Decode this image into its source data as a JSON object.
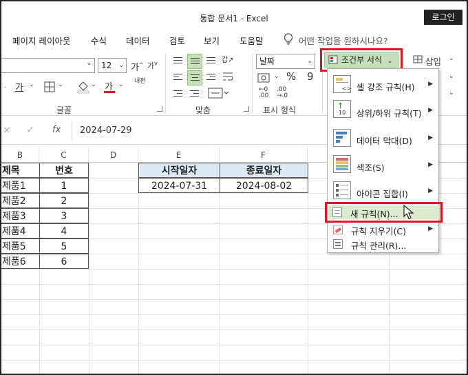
{
  "window": {
    "title": "통합 문서1 - Excel",
    "login_label": "로그인"
  },
  "menu_tabs": [
    "페이지 레이아웃",
    "수식",
    "데이터",
    "검토",
    "보기",
    "도움말"
  ],
  "tell_me": {
    "placeholder": "어떤 작업을 원하시나요?",
    "icon": "lightbulb-icon"
  },
  "ribbon": {
    "font_size": "12",
    "grow_font_label": "가",
    "shrink_font_label": "가",
    "bold_label": "가",
    "font_color_label": "가",
    "phonetic_label": "내천",
    "number_format": "날짜",
    "percent_label": "%",
    "comma_label": "9",
    "conditional_format_label": "조건부 서식",
    "insert_label": "삽입",
    "groups": {
      "font": "글꼴",
      "alignment": "맞춤",
      "number": "표시 형식"
    },
    "colors": {
      "active_fill": "#c6dfb9",
      "highlight_border": "#e0161d",
      "font_color_bar": "#e0161d"
    }
  },
  "formula_bar": {
    "cancel_icon": "×",
    "enter_icon": "✓",
    "fx_label": "fx",
    "value": "2024-07-29"
  },
  "columns": [
    "B",
    "C",
    "D",
    "E",
    "F"
  ],
  "table1": {
    "headers": [
      "제목",
      "번호"
    ],
    "rows": [
      [
        "제품1",
        "1"
      ],
      [
        "제품2",
        "2"
      ],
      [
        "제품3",
        "3"
      ],
      [
        "제품4",
        "4"
      ],
      [
        "제품5",
        "5"
      ],
      [
        "제품6",
        "6"
      ]
    ]
  },
  "table2": {
    "headers": [
      "시작일자",
      "종료일자"
    ],
    "row": [
      "2024-07-31",
      "2024-08-02"
    ]
  },
  "cf_menu": {
    "items": [
      {
        "label": "셀 강조 규칙(H)",
        "icon": "highlight-cells-icon"
      },
      {
        "label": "상위/하위 규칙(T)",
        "icon": "top-bottom-icon"
      },
      {
        "label": "데이터 막대(D)",
        "icon": "data-bars-icon"
      },
      {
        "label": "색조(S)",
        "icon": "color-scales-icon"
      },
      {
        "label": "아이콘 집합(I)",
        "icon": "icon-sets-icon"
      }
    ],
    "actions": [
      {
        "label": "새 규칙(N)...",
        "icon": "new-rule-icon"
      },
      {
        "label": "규칙 지우기(C)",
        "icon": "clear-rules-icon"
      },
      {
        "label": "규칙 관리(R)...",
        "icon": "manage-rules-icon"
      }
    ]
  }
}
